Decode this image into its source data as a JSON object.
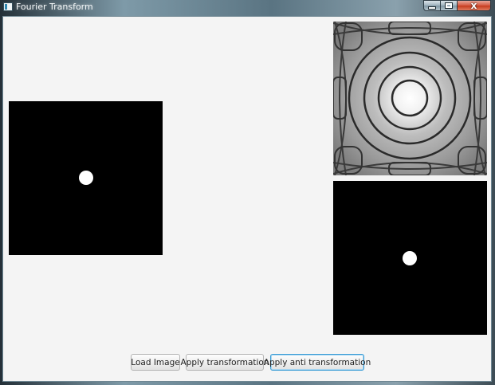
{
  "window": {
    "title": "Fourier Transform",
    "controls": [
      "minimize",
      "maximize",
      "close"
    ],
    "close_glyph": "x"
  },
  "images": {
    "input": "input-image",
    "spectrum": "fourier-spectrum-image",
    "output": "inverse-transform-image"
  },
  "buttons": {
    "load": "Load Image",
    "apply": "Apply transformation",
    "anti": "Apply anti transformation"
  },
  "colors": {
    "image_background": "#000000",
    "dot": "#ffffff",
    "focused_button_border": "#3b9dd6"
  }
}
